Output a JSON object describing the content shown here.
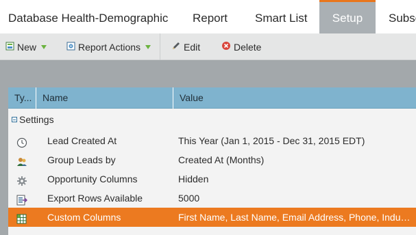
{
  "tabs": [
    {
      "label": "Database Health-Demographic",
      "active": false
    },
    {
      "label": "Report",
      "active": false
    },
    {
      "label": "Smart List",
      "active": false
    },
    {
      "label": "Setup",
      "active": true
    },
    {
      "label": "Subsc",
      "active": false
    }
  ],
  "toolbar": {
    "new_label": "New",
    "report_actions_label": "Report Actions",
    "edit_label": "Edit",
    "delete_label": "Delete"
  },
  "grid": {
    "columns": {
      "type": "Ty...",
      "name": "Name",
      "value": "Value"
    },
    "group_label": "Settings",
    "rows": [
      {
        "icon": "clock-icon",
        "name": "Lead Created At",
        "value": "This Year (Jan 1, 2015 - Dec 31, 2015 EDT)",
        "selected": false
      },
      {
        "icon": "group-people-icon",
        "name": "Group Leads by",
        "value": "Created At (Months)",
        "selected": false
      },
      {
        "icon": "gear-icon",
        "name": "Opportunity Columns",
        "value": "Hidden",
        "selected": false
      },
      {
        "icon": "export-icon",
        "name": "Export Rows Available",
        "value": "5000",
        "selected": false
      },
      {
        "icon": "custom-columns-icon",
        "name": "Custom Columns",
        "value": "First Name, Last Name, Email Address, Phone, Industr...",
        "selected": true
      }
    ]
  },
  "colors": {
    "accent": "#e9761d",
    "selected_row": "#ec7a20",
    "header_blue": "#7fb3ce",
    "active_tab": "#aab0b4"
  }
}
